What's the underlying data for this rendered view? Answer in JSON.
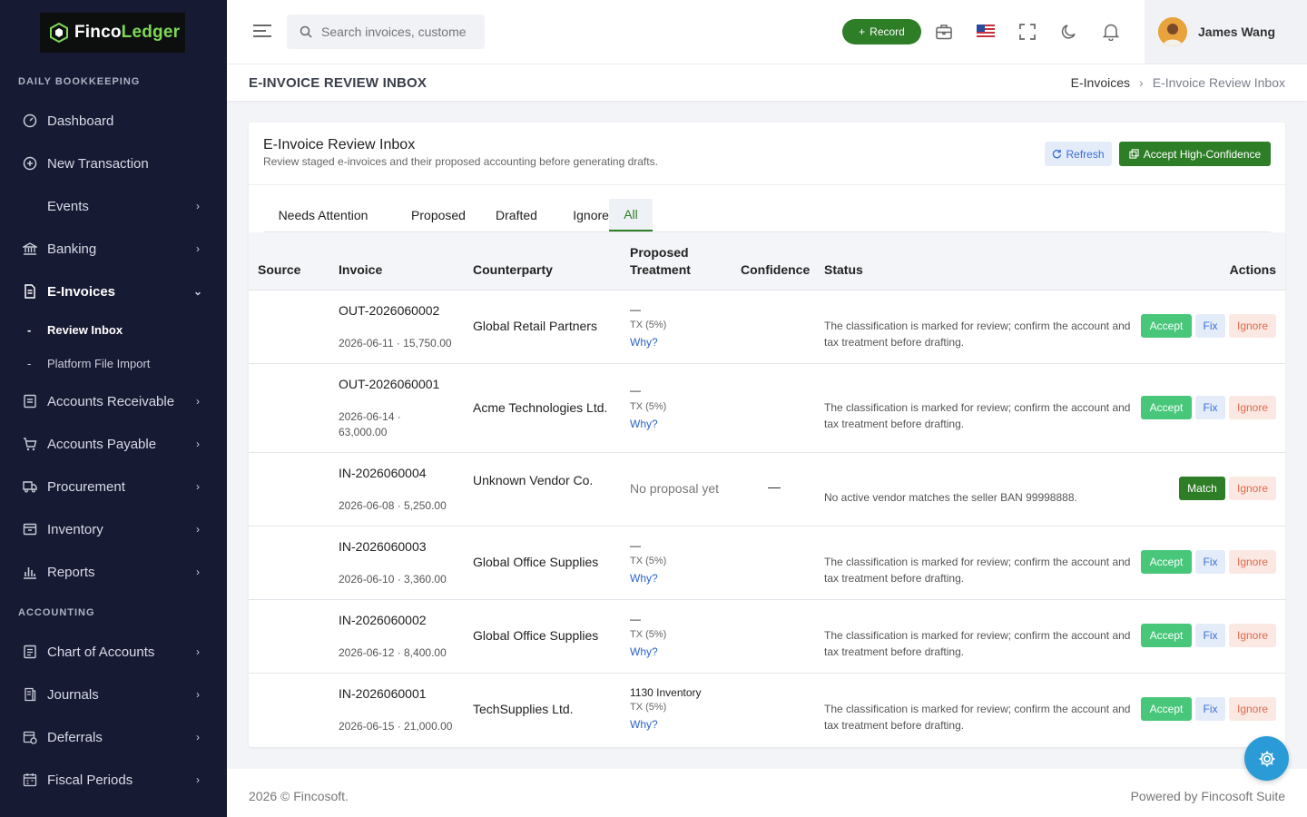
{
  "brand": {
    "name_a": "Finco",
    "name_b": "Ledger"
  },
  "sidebar": {
    "section_daily": "DAILY BOOKKEEPING",
    "section_accounting": "ACCOUNTING",
    "items": [
      {
        "label": "Dashboard"
      },
      {
        "label": "New Transaction"
      },
      {
        "label": "Events"
      },
      {
        "label": "Banking"
      },
      {
        "label": "E-Invoices"
      },
      {
        "label": "Accounts Receivable"
      },
      {
        "label": "Accounts Payable"
      },
      {
        "label": "Procurement"
      },
      {
        "label": "Inventory"
      },
      {
        "label": "Reports"
      },
      {
        "label": "Chart of Accounts"
      },
      {
        "label": "Journals"
      },
      {
        "label": "Deferrals"
      },
      {
        "label": "Fiscal Periods"
      }
    ],
    "sub_items": [
      {
        "label": "Review Inbox"
      },
      {
        "label": "Platform File Import"
      }
    ]
  },
  "topbar": {
    "search_placeholder": "Search invoices, customers...",
    "record_label": "Record",
    "user_name": "James Wang"
  },
  "titlebar": {
    "title": "E-INVOICE REVIEW INBOX",
    "breadcrumb_parent": "E-Invoices",
    "breadcrumb_current": "E-Invoice Review Inbox"
  },
  "card": {
    "title": "E-Invoice Review Inbox",
    "subtitle": "Review staged e-invoices and their proposed accounting before generating drafts.",
    "refresh_label": "Refresh",
    "accept_hc_label": "Accept High-Confidence"
  },
  "tabs": [
    "Needs Attention",
    "Proposed",
    "Drafted",
    "Ignored",
    "All"
  ],
  "active_tab": "All",
  "table": {
    "headers": {
      "source": "Source",
      "invoice": "Invoice",
      "counterparty": "Counterparty",
      "treatment_1": "Proposed",
      "treatment_2": "Treatment",
      "confidence": "Confidence",
      "status": "Status",
      "actions": "Actions"
    },
    "rows": [
      {
        "invoice": "OUT-2026060002",
        "meta": "2026-06-11 · 15,750.00",
        "counterparty": "Global Retail Partners",
        "treatment": "—",
        "tax": "TX (5%)",
        "why": "Why?",
        "status": "The classification is marked for review; confirm the account and tax treatment before drafting."
      },
      {
        "invoice": "OUT-2026060001",
        "meta": "2026-06-14 · 63,000.00",
        "counterparty": "Acme Technologies Ltd.",
        "treatment": "—",
        "tax": "TX (5%)",
        "why": "Why?",
        "status": "The classification is marked for review; confirm the account and tax treatment before drafting."
      },
      {
        "invoice": "IN-2026060004",
        "meta": "2026-06-08 · 5,250.00",
        "counterparty": "Unknown Vendor Co.",
        "treatment": "No proposal yet",
        "confidence": "—",
        "status": "No active vendor matches the seller BAN 99998888."
      },
      {
        "invoice": "IN-2026060003",
        "meta": "2026-06-10 · 3,360.00",
        "counterparty": "Global Office Supplies",
        "treatment": "—",
        "tax": "TX (5%)",
        "why": "Why?",
        "status": "The classification is marked for review; confirm the account and tax treatment before drafting."
      },
      {
        "invoice": "IN-2026060002",
        "meta": "2026-06-12 · 8,400.00",
        "counterparty": "Global Office Supplies",
        "treatment": "—",
        "tax": "TX (5%)",
        "why": "Why?",
        "status": "The classification is marked for review; confirm the account and tax treatment before drafting."
      },
      {
        "invoice": "IN-2026060001",
        "meta": "2026-06-15 · 21,000.00",
        "counterparty": "TechSupplies Ltd.",
        "treatment": "1130 Inventory",
        "tax": "TX (5%)",
        "why": "Why?",
        "status": "The classification is marked for review; confirm the account and tax treatment before drafting."
      }
    ],
    "actions": {
      "accept": "Accept",
      "fix": "Fix",
      "ignore": "Ignore",
      "match": "Match"
    }
  },
  "footer": {
    "left": "2026 © Fincosoft.",
    "right": "Powered by Fincosoft Suite"
  },
  "colors": {
    "sidebar": "#171a33",
    "primary_green": "#2e7d27",
    "accept_green": "#48c77a",
    "link_blue": "#2b64c8",
    "fab": "#2b9bd8"
  }
}
